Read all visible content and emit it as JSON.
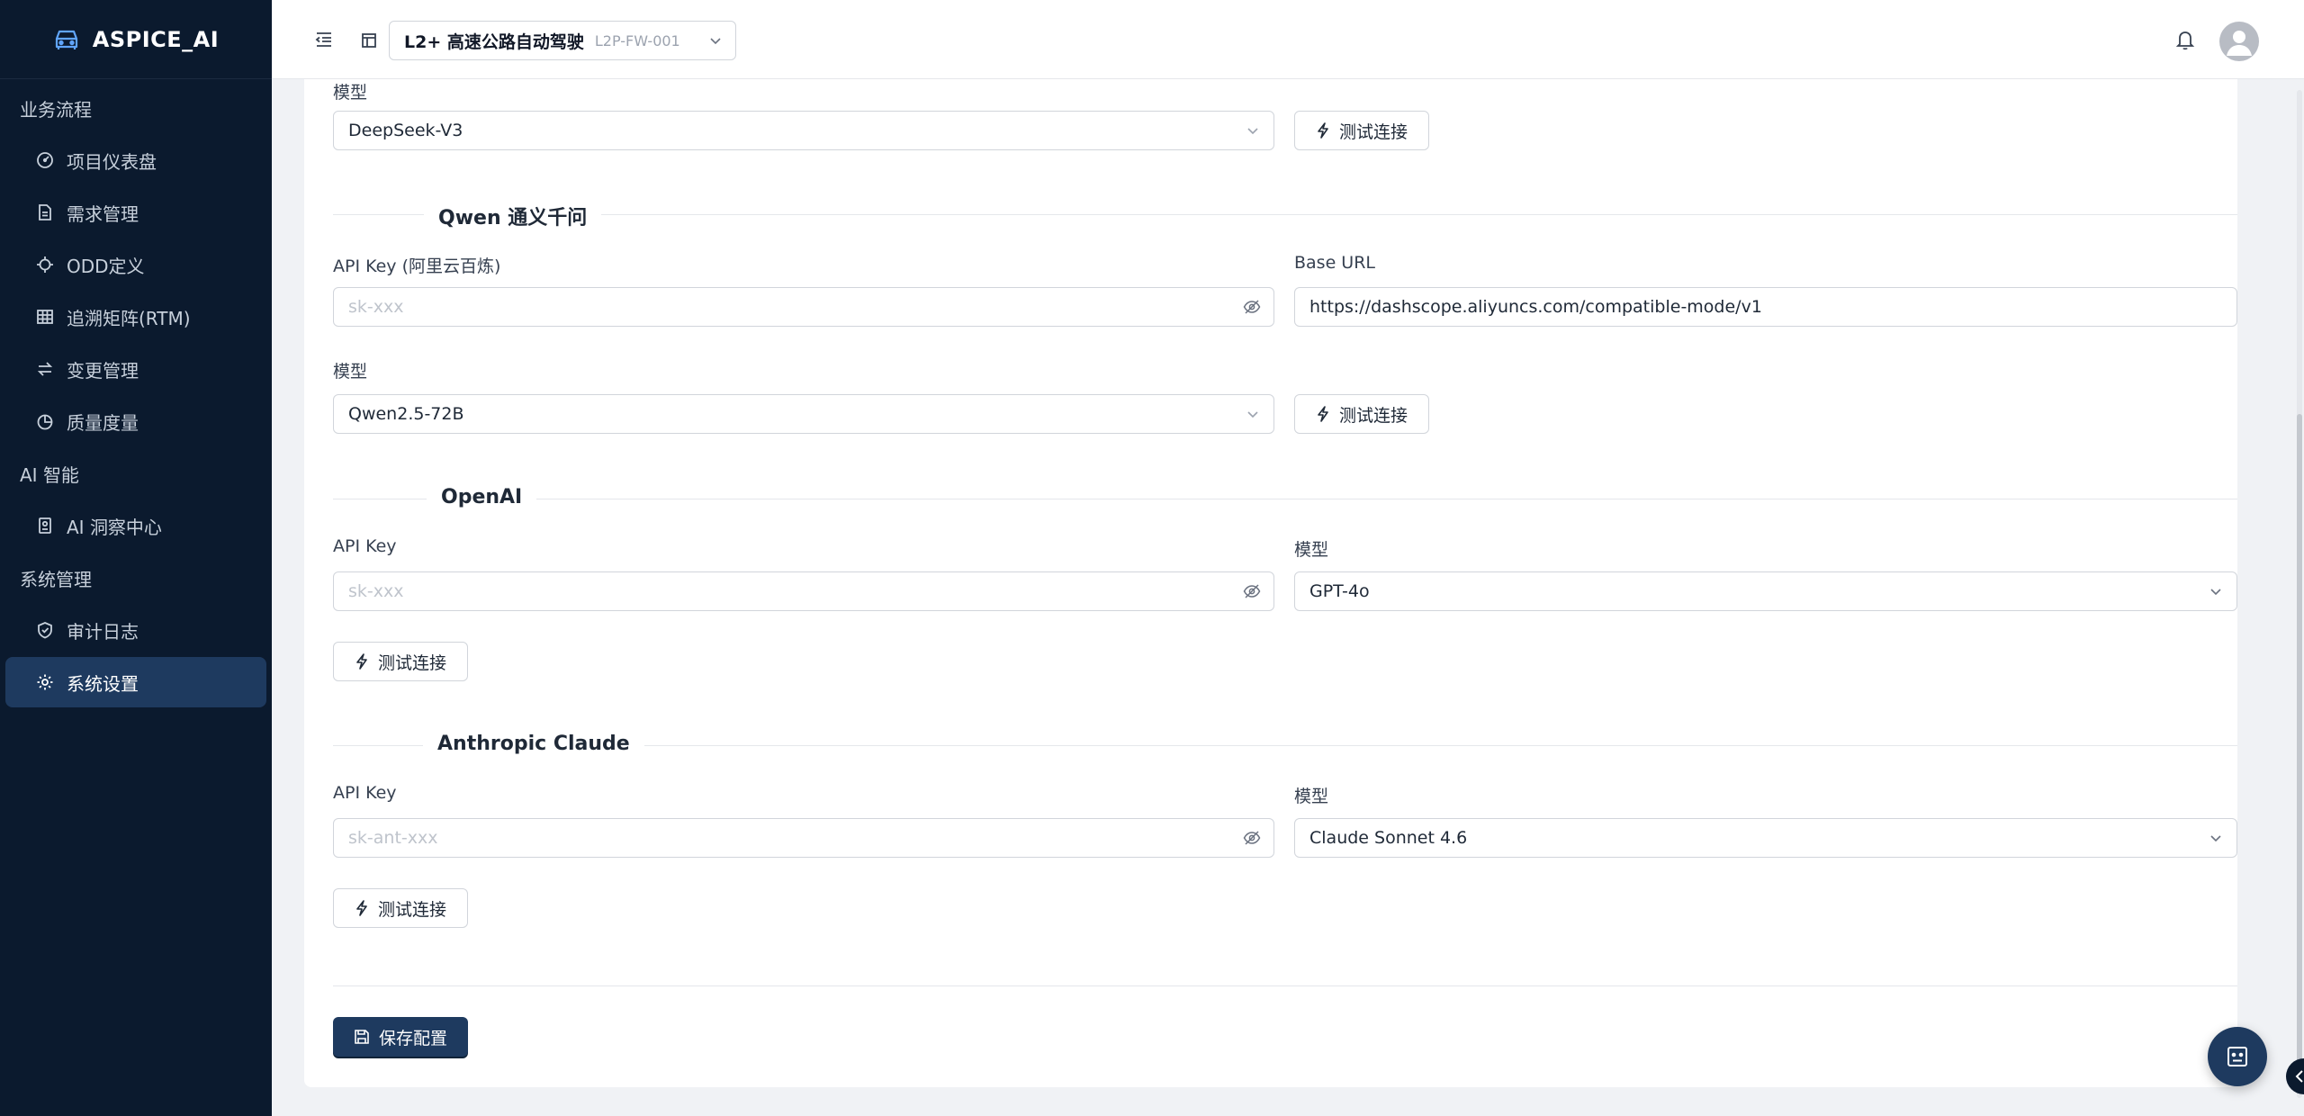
{
  "brand": {
    "name": "ASPICE_AI"
  },
  "sidebar": {
    "groups": [
      {
        "label": "业务流程",
        "items": [
          {
            "label": "项目仪表盘",
            "icon": "dashboard-icon"
          },
          {
            "label": "需求管理",
            "icon": "document-icon"
          },
          {
            "label": "ODD定义",
            "icon": "target-icon"
          },
          {
            "label": "追溯矩阵(RTM)",
            "icon": "grid-icon"
          },
          {
            "label": "变更管理",
            "icon": "swap-icon"
          },
          {
            "label": "质量度量",
            "icon": "pie-chart-icon"
          }
        ]
      },
      {
        "label": "AI 智能",
        "items": [
          {
            "label": "AI 洞察中心",
            "icon": "robot-icon"
          }
        ]
      },
      {
        "label": "系统管理",
        "items": [
          {
            "label": "审计日志",
            "icon": "shield-icon"
          },
          {
            "label": "系统设置",
            "icon": "gear-icon",
            "active": true
          }
        ]
      }
    ]
  },
  "header": {
    "project_name": "L2+ 高速公路自动驾驶",
    "project_code": "L2P-FW-001"
  },
  "deepseek": {
    "model_label": "模型",
    "model_value": "DeepSeek-V3",
    "test_label": "测试连接"
  },
  "qwen": {
    "title": "Qwen 通义千问",
    "api_key_label": "API Key (阿里云百炼)",
    "api_key_placeholder": "sk-xxx",
    "base_url_label": "Base URL",
    "base_url_value": "https://dashscope.aliyuncs.com/compatible-mode/v1",
    "model_label": "模型",
    "model_value": "Qwen2.5-72B",
    "test_label": "测试连接"
  },
  "openai": {
    "title": "OpenAI",
    "api_key_label": "API Key",
    "api_key_placeholder": "sk-xxx",
    "model_label": "模型",
    "model_value": "GPT-4o",
    "test_label": "测试连接"
  },
  "claude": {
    "title": "Anthropic Claude",
    "api_key_label": "API Key",
    "api_key_placeholder": "sk-ant-xxx",
    "model_label": "模型",
    "model_value": "Claude Sonnet 4.6",
    "test_label": "测试连接"
  },
  "actions": {
    "save_label": "保存配置"
  },
  "colors": {
    "sidebar_bg": "#0b1a2e",
    "accent": "#1e3a5f",
    "active_item": "#1e3a5f"
  }
}
